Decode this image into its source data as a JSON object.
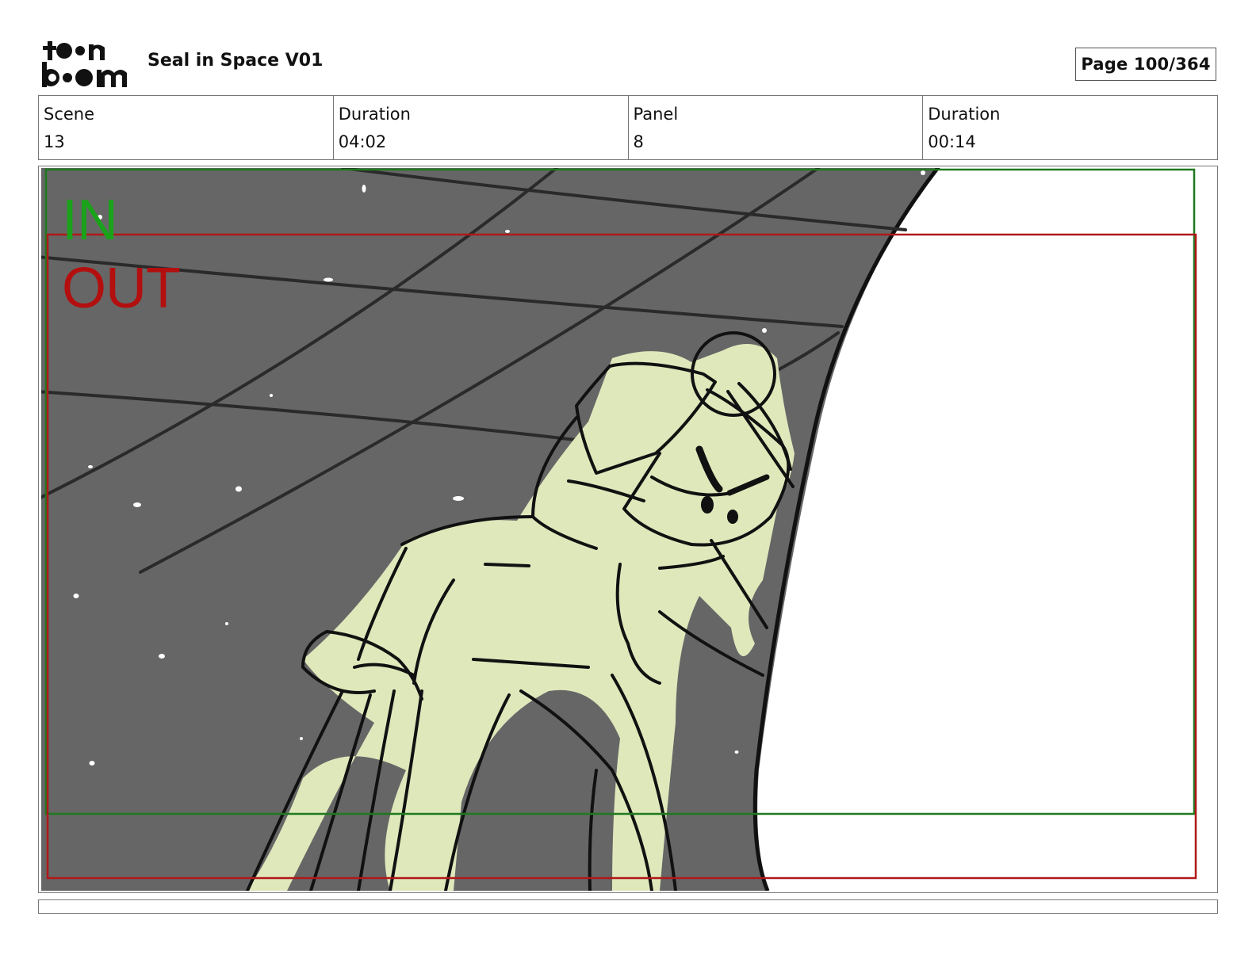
{
  "header": {
    "logo_text": "toon boom",
    "project_title": "Seal in Space V01",
    "page_label": "Page 100/364"
  },
  "info": [
    {
      "label": "Scene",
      "value": "13"
    },
    {
      "label": "Duration",
      "value": "04:02"
    },
    {
      "label": "Panel",
      "value": "8"
    },
    {
      "label": "Duration",
      "value": "00:14"
    }
  ],
  "panel": {
    "in_label": "IN",
    "out_label": "OUT",
    "colors": {
      "background": "#666666",
      "character_fill": "#dfe8bb",
      "in_frame": "#1e7a1e",
      "out_frame": "#b01818",
      "in_text": "#1aa31a",
      "out_text": "#b30f0f"
    }
  },
  "notes": ""
}
